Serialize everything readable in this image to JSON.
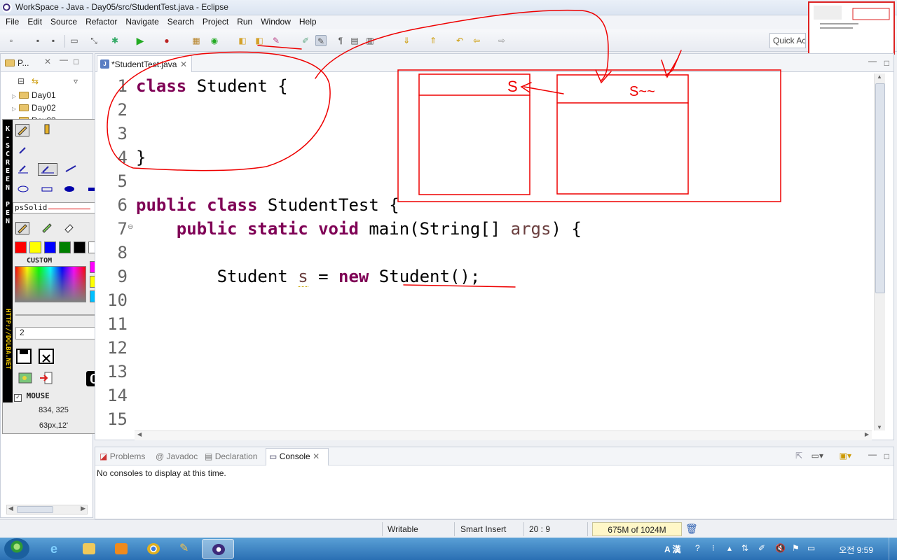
{
  "window": {
    "title": "WorkSpace - Java - Day05/src/StudentTest.java - Eclipse"
  },
  "menu": [
    "File",
    "Edit",
    "Source",
    "Refactor",
    "Navigate",
    "Search",
    "Project",
    "Run",
    "Window",
    "Help"
  ],
  "toolbar": {
    "quick_access": "Quick Ac"
  },
  "package_explorer": {
    "tab_label": "P...",
    "items": [
      "Day01",
      "Day02",
      "Day03"
    ]
  },
  "pen_tool": {
    "side_letters": [
      "K",
      "-",
      "S",
      "C",
      "R",
      "E",
      "E",
      "N",
      "",
      "P",
      "E",
      "N"
    ],
    "url": "HTTP://DOLBA.NET",
    "line_style": "psSolid",
    "custom_label": "CUSTOM",
    "width_value": "2",
    "mouse_label": "MOUSE",
    "coords": "834, 325",
    "size": "63px,12'",
    "colors": [
      "#ff0000",
      "#ffff00",
      "#0000ff",
      "#008000",
      "#000000",
      "#ffffff"
    ],
    "custom_colors": [
      "#ff00ff",
      "#ffff00",
      "#00c0ff"
    ]
  },
  "editor": {
    "tab_label": "*StudentTest.java",
    "line_numbers": [
      "1",
      "2",
      "3",
      "4",
      "5",
      "6",
      "7",
      "8",
      "9",
      "10",
      "11",
      "12",
      "13",
      "14",
      "15"
    ]
  },
  "bottom_panel": {
    "tabs": [
      "Problems",
      "Javadoc",
      "Declaration",
      "Console"
    ],
    "message": "No consoles to display at this time."
  },
  "status": {
    "writable": "Writable",
    "insert_mode": "Smart Insert",
    "position": "20 : 9",
    "heap": "675M of 1024M"
  },
  "taskbar": {
    "clock": "오전 9:59",
    "ime": "A 漢"
  },
  "annotation": {
    "box1_label": "S",
    "box2_label": "S~~"
  }
}
